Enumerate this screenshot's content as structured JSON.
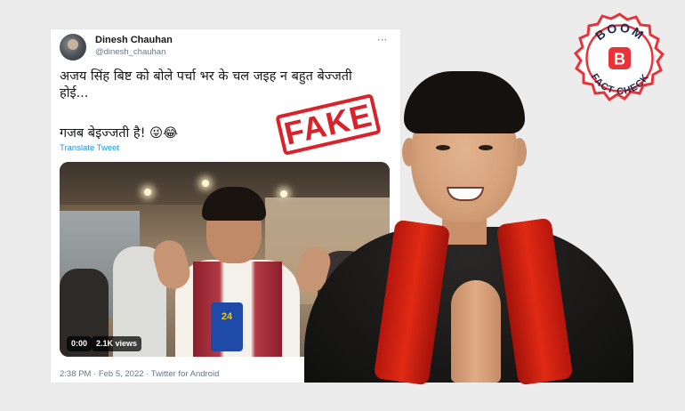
{
  "tweet": {
    "display_name": "Dinesh Chauhan",
    "handle": "@dinesh_chauhan",
    "more_icon": "⋯",
    "text_line1": "अजय सिंह बिष्ट को बोले पर्चा भर के चल जइह न बहुत बेज्जती होई...",
    "text_line2": "गजब बेइज्जती है! 😜😂",
    "translate_label": "Translate Tweet",
    "video": {
      "elapsed": "0:00",
      "views": "2.1K views",
      "mic_label": "24"
    },
    "meta": "2:38 PM · Feb 5, 2022 · Twitter for Android"
  },
  "stamp": {
    "label": "FAKE",
    "color": "#d9232a"
  },
  "badge": {
    "top_text": "BOOM",
    "letter": "B",
    "bottom_text": "FACT CHECK",
    "color": "#e8333a"
  },
  "colors": {
    "background": "#ececec",
    "link": "#1b95e0",
    "muted": "#657786"
  }
}
